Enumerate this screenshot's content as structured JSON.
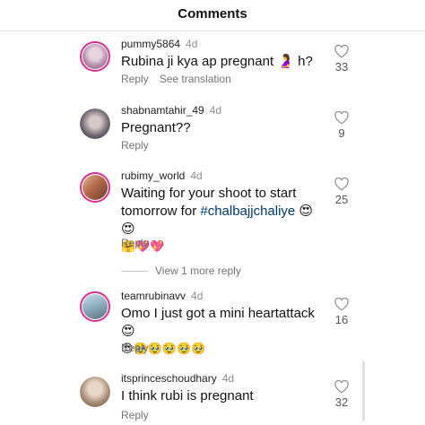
{
  "header": {
    "title": "Comments"
  },
  "comments": [
    {
      "username": "pummy5864",
      "age": "4d",
      "text": "Rubina ji kya ap pregnant 🤰 h?",
      "reply": "Reply",
      "translate": "See translation",
      "likes": "33",
      "avatar_color": "#c9a8c6"
    },
    {
      "username": "shabnamtahir_49",
      "age": "4d",
      "text": "Pregnant??",
      "reply": "Reply",
      "likes": "9",
      "avatar_color": "#5b5560"
    },
    {
      "username": "rubimy_world",
      "age": "4d",
      "text_line1": "Waiting for your shoot to start",
      "text_line2_prefix": "tomorrow for ",
      "hashtag": "#chalbajjchaliye",
      "text_line2_suffix": " 😍😍",
      "text_line3": "🤗💖💖",
      "reply": "Reply",
      "likes": "25",
      "avatar_color": "#b9795a"
    },
    {
      "username": "teamrubinavv",
      "age": "4d",
      "text_line1": "Omo I just got a mini heartattack 😍",
      "text_line2": "😍🥹🥹🥹🥹🥹",
      "reply": "Reply",
      "likes": "16",
      "avatar_color": "#8db0c2"
    },
    {
      "username": "itsprinceschoudhary",
      "age": "4d",
      "text": "I think rubi is pregnant",
      "reply": "Reply",
      "likes": "32",
      "avatar_color": "#a58a74"
    }
  ],
  "view_more": "View 1 more reply",
  "colors": {
    "ring": "#d62f8f",
    "hashtag": "#00376b",
    "muted": "#737373"
  },
  "icons": {
    "like": "heart-outline-icon"
  }
}
